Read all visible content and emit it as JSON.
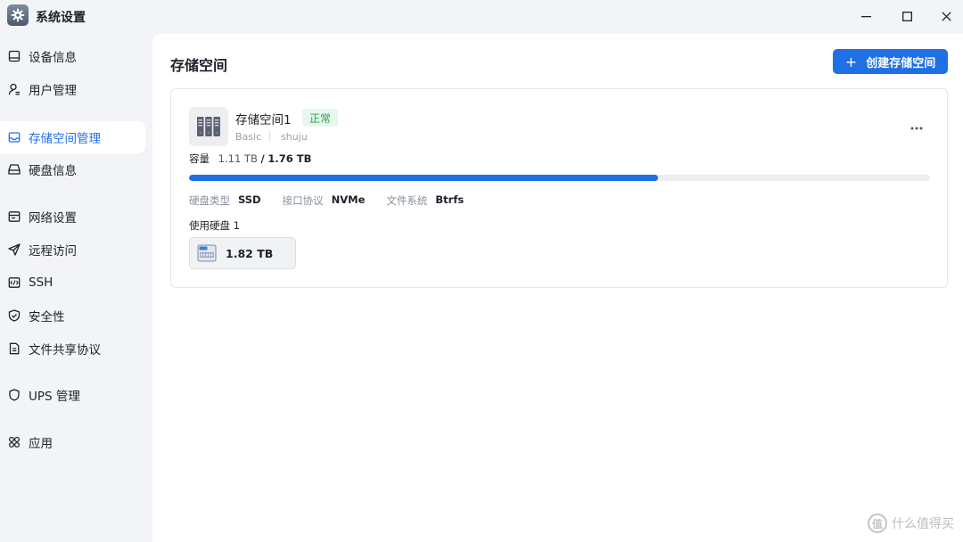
{
  "window": {
    "title": "系统设置"
  },
  "sidebar": {
    "items": [
      {
        "label": "设备信息",
        "icon": "device-icon"
      },
      {
        "label": "用户管理",
        "icon": "user-icon"
      },
      {
        "label": "存储空间管理",
        "icon": "storage-icon",
        "active": true
      },
      {
        "label": "硬盘信息",
        "icon": "harddisk-icon"
      },
      {
        "label": "网络设置",
        "icon": "network-icon"
      },
      {
        "label": "远程访问",
        "icon": "send-icon"
      },
      {
        "label": "SSH",
        "icon": "terminal-icon"
      },
      {
        "label": "安全性",
        "icon": "shield-icon"
      },
      {
        "label": "文件共享协议",
        "icon": "file-icon"
      },
      {
        "label": "UPS 管理",
        "icon": "ups-shield-icon"
      },
      {
        "label": "应用",
        "icon": "apps-icon"
      }
    ]
  },
  "main": {
    "title": "存储空间",
    "create_button": {
      "icon": "+",
      "label": "创建存储空间"
    },
    "pool": {
      "name": "存储空间1",
      "status": "正常",
      "type": "Basic",
      "filesystem_tag": "shuju",
      "capacity_label": "容量",
      "used": "1.11 TB",
      "separator": "/",
      "total": "1.76 TB",
      "usage_fraction": 0.633,
      "props": [
        {
          "label": "硬盘类型",
          "value": "SSD"
        },
        {
          "label": "接口协议",
          "value": "NVMe"
        },
        {
          "label": "文件系统",
          "value": "Btrfs"
        }
      ],
      "disks_label": "使用硬盘 1",
      "disks": [
        {
          "size": "1.82 TB"
        }
      ]
    }
  },
  "watermark": {
    "text": "什么值得买",
    "glyph": "值"
  },
  "colors": {
    "accent": "#1f6fe5",
    "status_ok_bg": "#e8f7ec",
    "status_ok_text": "#2f9e50",
    "sidebar_bg": "#f2f4f7"
  }
}
